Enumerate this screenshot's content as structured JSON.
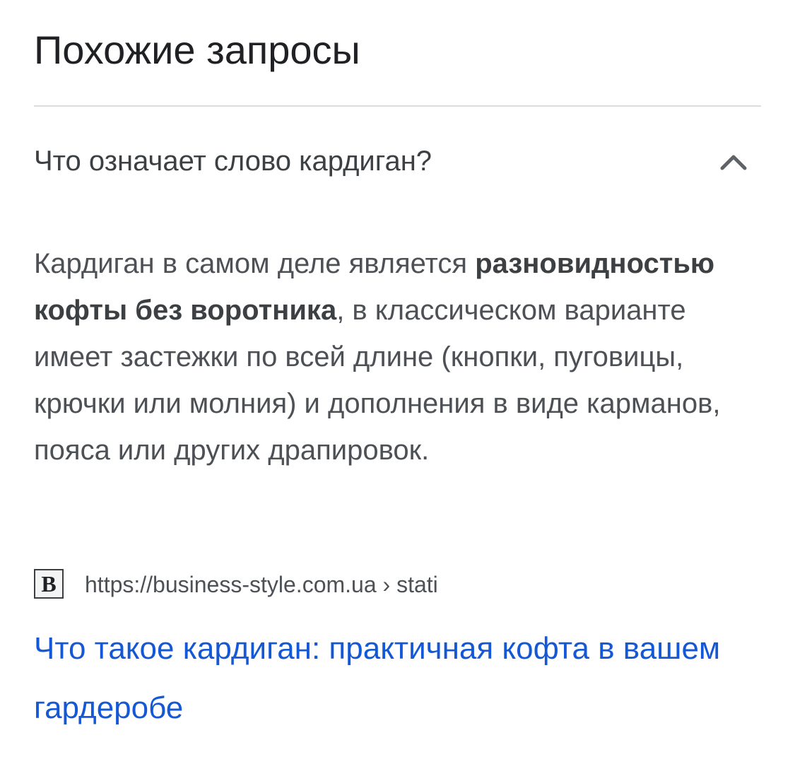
{
  "section": {
    "title": "Похожие запросы"
  },
  "question": {
    "text": "Что означает слово кардиган?",
    "expanded": true,
    "chevron_icon": "chevron-up-icon"
  },
  "answer": {
    "before_bold": "Кардиган в самом деле является ",
    "bold": "разновидностью кофты без воротника",
    "after_bold": ", в классическом варианте имеет застежки по всей длине (кнопки, пуговицы, крючки или молния) и дополнения в виде карманов, пояса или других драпировок."
  },
  "source": {
    "favicon_letter": "B",
    "url": "https://business-style.com.ua › stati"
  },
  "result": {
    "title": "Что такое кардиган: практичная кофта в вашем гардеробе"
  },
  "colors": {
    "link": "#1558d6",
    "text": "#202124",
    "muted": "#4d5156",
    "divider": "#dadce0"
  }
}
